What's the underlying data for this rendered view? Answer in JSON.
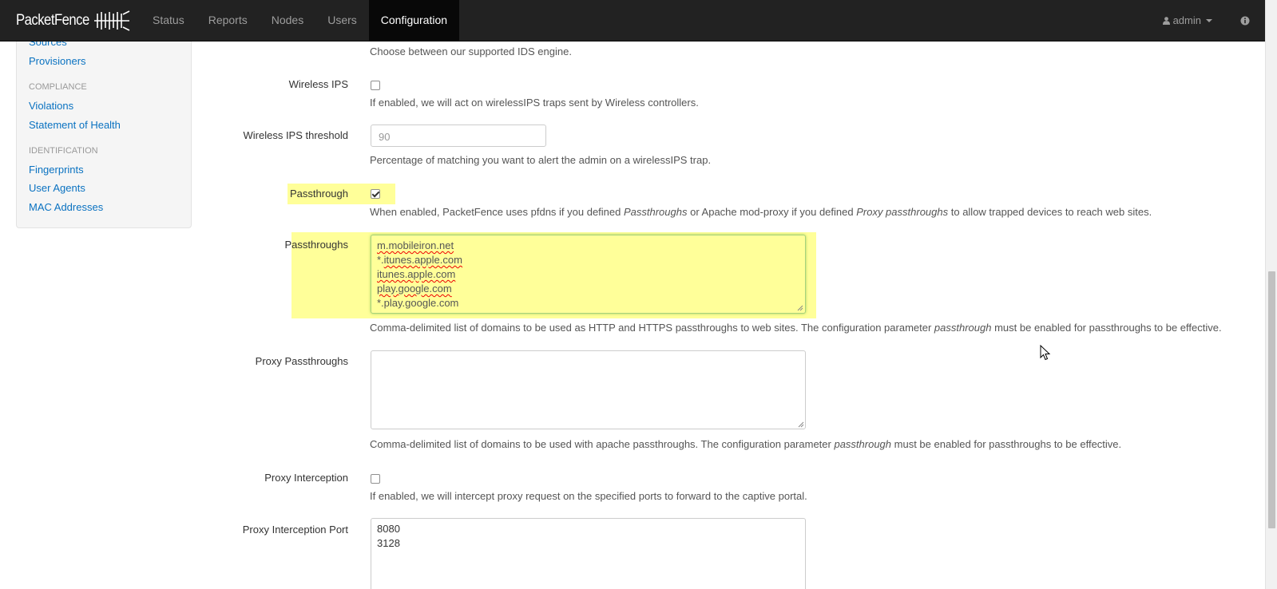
{
  "navbar": {
    "brand": "PacketFence",
    "items": [
      {
        "label": "Status",
        "active": false
      },
      {
        "label": "Reports",
        "active": false
      },
      {
        "label": "Nodes",
        "active": false
      },
      {
        "label": "Users",
        "active": false
      },
      {
        "label": "Configuration",
        "active": true
      }
    ],
    "user_label": "admin",
    "user_icon": "user-icon",
    "info_icon": "info-icon"
  },
  "sidebar": {
    "partial_link": "Sources",
    "provisioners": "Provisioners",
    "compliance_header": "COMPLIANCE",
    "violations": "Violations",
    "statement_of_health": "Statement of Health",
    "identification_header": "IDENTIFICATION",
    "fingerprints": "Fingerprints",
    "user_agents": "User Agents",
    "mac_addresses": "MAC Addresses"
  },
  "form": {
    "ids_engine_help": "Choose between our supported IDS engine.",
    "wireless_ips": {
      "label": "Wireless IPS",
      "checked": false,
      "help": "If enabled, we will act on wirelessIPS traps sent by Wireless controllers."
    },
    "wireless_ips_threshold": {
      "label": "Wireless IPS threshold",
      "placeholder": "90",
      "help": "Percentage of matching you want to alert the admin on a wirelessIPS trap."
    },
    "passthrough": {
      "label": "Passthrough",
      "checked": true,
      "help_1": "When enabled, PacketFence uses pfdns if you defined ",
      "help_em_1": "Passthroughs",
      "help_2": " or Apache mod-proxy if you defined ",
      "help_em_2": "Proxy passthroughs",
      "help_3": " to allow trapped devices to reach web sites."
    },
    "passthroughs": {
      "label": "Passthroughs",
      "lines": [
        "m.mobileiron.net",
        "*.itunes.apple.com",
        "itunes.apple.com",
        "play.google.com",
        "*.play.google.com"
      ],
      "help_1": "Comma-delimited list of domains to be used as HTTP and HTTPS passthroughs to web sites. The configuration parameter ",
      "help_em": "passthrough",
      "help_2": " must be enabled for passthroughs to be effective."
    },
    "proxy_passthroughs": {
      "label": "Proxy Passthroughs",
      "value": "",
      "help_1": "Comma-delimited list of domains to be used with apache passthroughs. The configuration parameter ",
      "help_em": "passthrough",
      "help_2": " must be enabled for passthroughs to be effective."
    },
    "proxy_interception": {
      "label": "Proxy Interception",
      "checked": false,
      "help": "If enabled, we will intercept proxy request on the specified ports to forward to the captive portal."
    },
    "proxy_interception_port": {
      "label": "Proxy Interception Port",
      "lines": [
        "8080",
        "3128"
      ]
    }
  },
  "colors": {
    "navbar_bg": "#222222",
    "link": "#0a72c1",
    "highlight": "#ffff99"
  }
}
